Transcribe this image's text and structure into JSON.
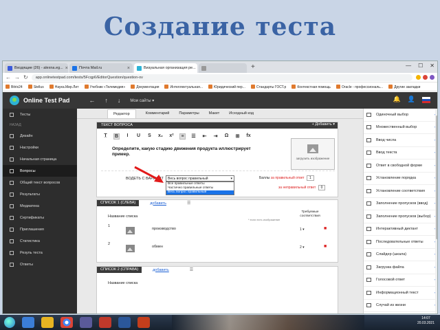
{
  "slide": {
    "title": "Создание теста"
  },
  "browser": {
    "tabs": [
      {
        "label": "Входящие (26) - alexna.eg...",
        "active": false,
        "color": "#3b5bdb"
      },
      {
        "label": "Почта Mail.ru",
        "active": false,
        "color": "#1a73e8"
      },
      {
        "label": "Визуальная организация ре...",
        "active": true,
        "color": "#2db3d6"
      },
      {
        "label": "",
        "active": false,
        "color": "#999999"
      }
    ],
    "new_tab": "+",
    "window_controls": [
      "—",
      "☐",
      "✕"
    ],
    "url": "app.onlinetestpad.com/tests/5Fcqp6/EditorQuestion/question-ov",
    "bookmarks": [
      "Bitrix24",
      "Stellus",
      "Наука.Мир.Лит",
      "Учебник «Телемедия»",
      "Документация",
      "Интеллектуальная...",
      "Юридический пер...",
      "Стандарты ГОСТ.р",
      "Контекстная помощь",
      "Oracle - профессиональ...",
      "Другие закладки"
    ]
  },
  "app": {
    "brand": "Online Test Pad",
    "site_menu": "Мои сайты ▾",
    "sidebar_head": "НАЗАД",
    "sidebar": [
      {
        "label": "Тесты",
        "active": false
      },
      {
        "label": "Дизайн",
        "active": false
      },
      {
        "label": "Настройки",
        "active": false
      },
      {
        "label": "Начальная страница",
        "active": false
      },
      {
        "label": "Вопросы",
        "active": true
      },
      {
        "label": "Общий текст вопросов",
        "active": false
      },
      {
        "label": "Результаты",
        "active": false
      },
      {
        "label": "Медиатека",
        "active": false
      },
      {
        "label": "Сертификаты",
        "active": false
      },
      {
        "label": "Приглашения",
        "active": false
      },
      {
        "label": "Статистика",
        "active": false
      },
      {
        "label": "Резуль теста",
        "active": false
      },
      {
        "label": "Ответы",
        "active": false
      }
    ],
    "editor_tabs": [
      "Редактор",
      "Комментарий",
      "Параметры",
      "Макет",
      "Исходный код"
    ],
    "question_panel": {
      "title": "ТЕКСТ ВОПРОСА",
      "add_link": "+ Добавить ▾",
      "toolbar": [
        "T̲",
        "B",
        "I",
        "U",
        "S",
        "x₂",
        "x²",
        "≡",
        "☰",
        "⇤",
        "⇥",
        "Ω",
        "⊞",
        "fx"
      ],
      "question_text": "Определите, какую стадию движения продукта иллюстрирует пример.",
      "image_caption": "загрузить изображение",
      "answer_label": "ВОДЕТЬ С ВАРИАНТ",
      "answer_select": "Весь вопрос правильный",
      "dropdown_options": [
        "Все правильные ответы",
        "Частично правильные ответы",
        "Весь вопрос правильный"
      ],
      "selected_option_index": 2,
      "hint1_prefix": "Баллы",
      "hint1_red": "за правильный ответ",
      "hint1_value": "1",
      "hint2_red": "за неправильный ответ",
      "hint2_value": "0"
    },
    "list_left": {
      "title": "СПИСОК 1 (СЛЕВА)",
      "add_link": "добавить",
      "col_name": "Название списка",
      "col_hint": "* если есть изображение",
      "col_req": "Требуемые соответствия",
      "rows": [
        {
          "n": "1",
          "text": "производство",
          "count": "1 ▾"
        },
        {
          "n": "2",
          "text": "обмен",
          "count": "2 ▾"
        }
      ]
    },
    "list_right": {
      "title": "СПИСОК 2 (СПРАВА)",
      "add_link": "добавить",
      "col_name": "Название списка"
    },
    "palette": [
      "Одиночный выбор",
      "Множественный выбор",
      "Ввод числа",
      "Ввод текста",
      "Ответ в свободной форме",
      "Установление порядка",
      "Установление соответствия",
      "Заполнение пропусков (ввод)",
      "Заполнение пропусков (выбор)",
      "Интерактивный диктант",
      "Последовательные ответы",
      "Слайдер (шкала)",
      "Загрузка файла",
      "Голосовой ответ",
      "Информационный текст",
      "Случай из жизни"
    ]
  },
  "taskbar": {
    "time": "14:07",
    "date": "20.03.2021"
  },
  "colors": {
    "accent": "#3a63a4",
    "topbar": "#373737",
    "sidebar": "#2d2d2d",
    "red": "#d22222",
    "link": "#1a5fd4"
  }
}
